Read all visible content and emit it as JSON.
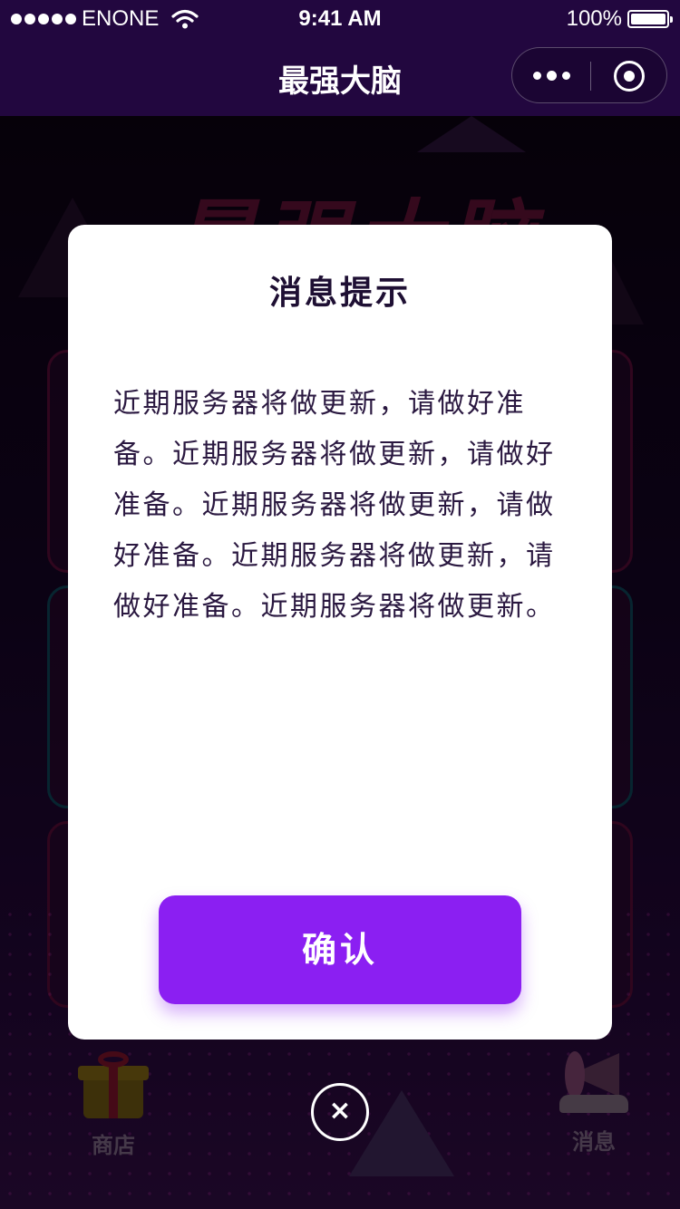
{
  "status_bar": {
    "carrier": "ENONE",
    "time": "9:41 AM",
    "battery_text": "100%",
    "battery_level": 1.0,
    "signal_icon": "signal-dots-icon",
    "wifi_icon": "wifi-icon",
    "battery_icon": "battery-icon"
  },
  "nav": {
    "title": "最强大脑",
    "more_icon": "more-dots-icon",
    "close_icon": "target-circle-icon"
  },
  "background": {
    "logo_text": "最强大脑",
    "tabs": [
      {
        "label": "商店",
        "icon": "gift-box-icon"
      },
      {
        "label": "消息",
        "icon": "megaphone-icon"
      }
    ],
    "close_glyph": "×"
  },
  "modal": {
    "title": "消息提示",
    "body": "近期服务器将做更新，请做好准备。近期服务器将做更新，请做好准备。近期服务器将做更新，请做好准备。近期服务器将做更新，请做好准备。近期服务器将做更新。",
    "confirm_label": "确认"
  },
  "colors": {
    "nav_bg": "#22073f",
    "accent_button": "#8b1ff2",
    "modal_title": "#1e0f33"
  }
}
